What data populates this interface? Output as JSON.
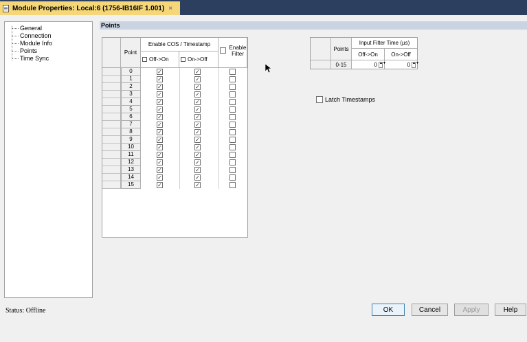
{
  "window": {
    "title": "Module Properties: Local:6 (1756-IB16IF 1.001)",
    "close_glyph": "×"
  },
  "tree": {
    "items": [
      "General",
      "Connection",
      "Module Info",
      "Points",
      "Time Sync"
    ]
  },
  "section_title": "Points",
  "grid": {
    "col_point": "Point",
    "col_cos": "Enable COS / Timestamp",
    "col_off_on": "Off->On",
    "col_on_off": "On->Off",
    "col_filter": "Enable Filter",
    "rows": [
      {
        "point": "0",
        "off_on": true,
        "on_off": true,
        "filter": false
      },
      {
        "point": "1",
        "off_on": true,
        "on_off": true,
        "filter": false
      },
      {
        "point": "2",
        "off_on": true,
        "on_off": true,
        "filter": false
      },
      {
        "point": "3",
        "off_on": true,
        "on_off": true,
        "filter": false
      },
      {
        "point": "4",
        "off_on": true,
        "on_off": true,
        "filter": false
      },
      {
        "point": "5",
        "off_on": true,
        "on_off": true,
        "filter": false
      },
      {
        "point": "6",
        "off_on": true,
        "on_off": true,
        "filter": false
      },
      {
        "point": "7",
        "off_on": true,
        "on_off": true,
        "filter": false
      },
      {
        "point": "8",
        "off_on": true,
        "on_off": true,
        "filter": false
      },
      {
        "point": "9",
        "off_on": true,
        "on_off": true,
        "filter": false
      },
      {
        "point": "10",
        "off_on": true,
        "on_off": true,
        "filter": false
      },
      {
        "point": "11",
        "off_on": true,
        "on_off": true,
        "filter": false
      },
      {
        "point": "12",
        "off_on": true,
        "on_off": true,
        "filter": false
      },
      {
        "point": "13",
        "off_on": true,
        "on_off": true,
        "filter": false
      },
      {
        "point": "14",
        "off_on": true,
        "on_off": true,
        "filter": false
      },
      {
        "point": "15",
        "off_on": true,
        "on_off": true,
        "filter": false
      }
    ]
  },
  "filter_table": {
    "col_points": "Points",
    "col_title": "Input Filter Time (µs)",
    "col_off_on": "Off->On",
    "col_on_off": "On->Off",
    "row": {
      "points": "0-15",
      "off_on": "0",
      "on_off": "0"
    }
  },
  "latch": {
    "label": "Latch Timestamps",
    "checked": false
  },
  "status": "Status:  Offline",
  "buttons": {
    "ok": "OK",
    "cancel": "Cancel",
    "apply": "Apply",
    "help": "Help"
  },
  "colors": {
    "titlebar": "#2d3f5e",
    "tab": "#f5d77a",
    "panel_header": "#c9d3e1"
  }
}
